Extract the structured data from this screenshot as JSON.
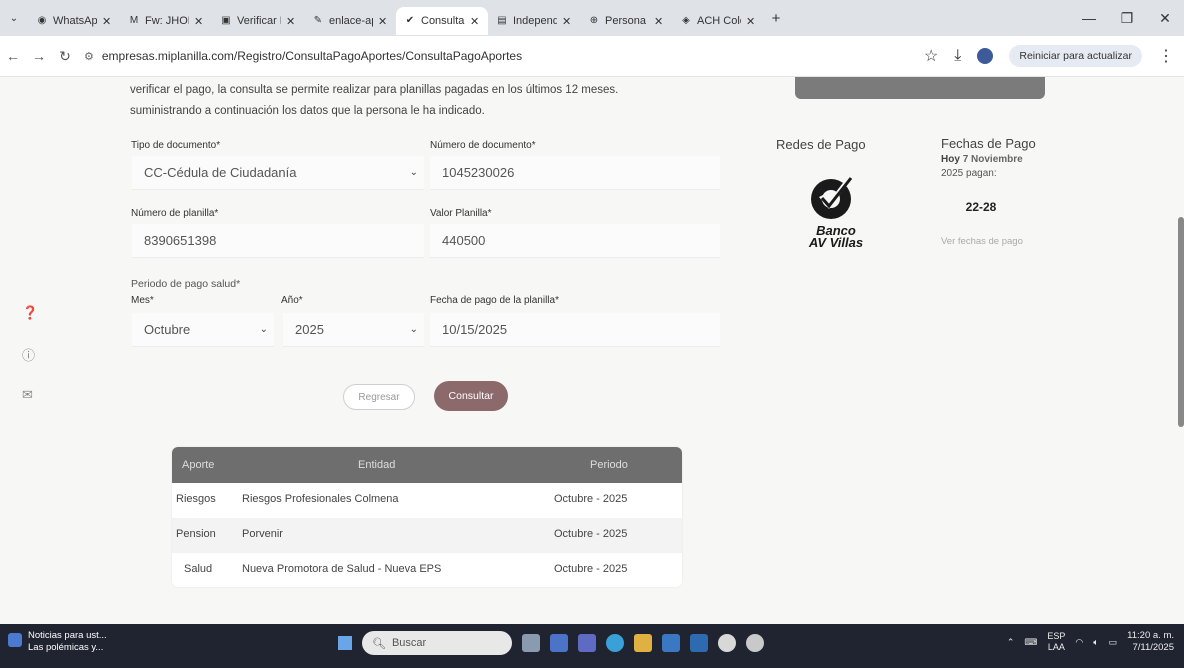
{
  "browser": {
    "tabs": [
      {
        "label": "WhatsApp",
        "icon": "whatsapp-icon"
      },
      {
        "label": "Fw: JHON C",
        "icon": "gmail-icon"
      },
      {
        "label": "Verificar Pla",
        "icon": "planilla-icon"
      },
      {
        "label": "enlace-apt",
        "icon": "link-icon"
      },
      {
        "label": "Consulta de",
        "icon": "check-icon",
        "active": true
      },
      {
        "label": "Independi",
        "icon": "si-icon"
      },
      {
        "label": "Persona",
        "icon": "globe-icon"
      },
      {
        "label": "ACH Colom",
        "icon": "ach-icon"
      }
    ],
    "url": "empresas.miplanilla.com/Registro/ConsultaPagoAportes/ConsultaPagoAportes",
    "update_button": "Reiniciar para actualizar"
  },
  "intro": {
    "line1": "verificar el pago, la consulta se permite realizar para planillas pagadas en los últimos 12 meses.",
    "line2": "suministrando a continuación los datos que la persona le ha indicado."
  },
  "form": {
    "tipo_label": "Tipo de documento*",
    "tipo_value": "CC-Cédula de Ciudadanía",
    "numero_doc_label": "Número de documento*",
    "numero_doc_value": "1045230026",
    "numero_planilla_label": "Número de planilla*",
    "numero_planilla_value": "8390651398",
    "valor_label": "Valor Planilla*",
    "valor_value": "440500",
    "periodo_label": "Periodo de pago salud*",
    "mes_label": "Mes*",
    "mes_value": "Octubre",
    "anio_label": "Año*",
    "anio_value": "2025",
    "fecha_label": "Fecha de pago de la planilla*",
    "fecha_value": "10/15/2025",
    "regresar": "Regresar",
    "consultar": "Consultar"
  },
  "results": {
    "headers": [
      "Aporte",
      "Entidad",
      "Periodo"
    ],
    "rows": [
      {
        "aporte": "Riesgos",
        "entidad": "Riesgos Profesionales Colmena",
        "periodo": "Octubre - 2025"
      },
      {
        "aporte": "Pension",
        "entidad": "Porvenir",
        "periodo": "Octubre - 2025"
      },
      {
        "aporte": "Salud",
        "entidad": "Nueva Promotora de Salud - Nueva EPS",
        "periodo": "Octubre - 2025"
      }
    ]
  },
  "sidebar_right": {
    "redes_title": "Redes de Pago",
    "banco_line1": "Banco",
    "banco_line2": "AV Villas",
    "fechas_title": "Fechas de Pago",
    "hoy_prefix": "Hoy",
    "hoy_date": "7 Noviembre",
    "year_pagan": "2025 pagan:",
    "range": "22-28",
    "ver_fechas": "Ver fechas de pago"
  },
  "taskbar": {
    "news_line1": "Noticias para ust...",
    "news_line2": "Las polémicas y...",
    "search_placeholder": "Buscar",
    "lang_line1": "ESP",
    "lang_line2": "LAA",
    "time": "11:20 a. m.",
    "date": "7/11/2025"
  }
}
